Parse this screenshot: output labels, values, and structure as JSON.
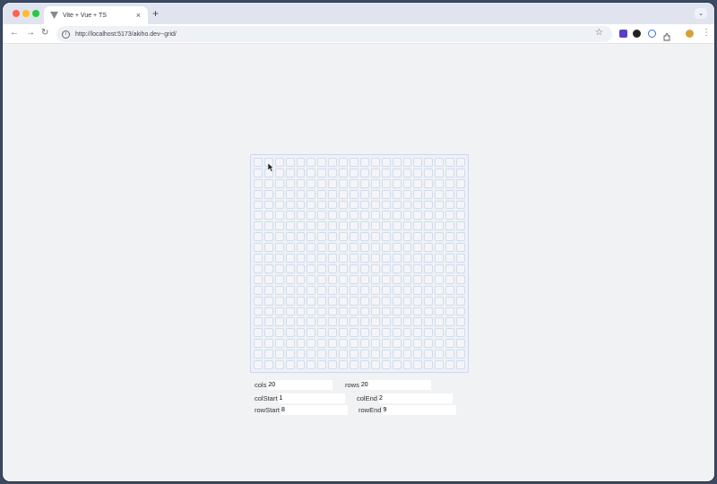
{
  "browser": {
    "tab_title": "Vite + Vue + TS",
    "tab_close": "×",
    "new_tab": "+",
    "tabstrip_menu": "⌄",
    "url": "http://localhost:5173/akiho.dev--grid/",
    "back": "←",
    "forward": "→",
    "reload": "↻",
    "star": "☆",
    "menu": "⋮"
  },
  "grid": {
    "cols": 20,
    "rows": 20
  },
  "controls": {
    "cols_label": "cols",
    "cols_value": "20",
    "rows_label": "rows",
    "rows_value": "20",
    "col_start_label": "colStart",
    "col_start_value": "1",
    "col_end_label": "colEnd",
    "col_end_value": "2",
    "row_start_label": "rowStart",
    "row_start_value": "8",
    "row_end_label": "rowEnd",
    "row_end_value": "9"
  },
  "colors": {
    "accent_extension": "#5b3fc4",
    "grid_border": "#d3dcea"
  },
  "icons": [
    "vite-favicon",
    "info-icon",
    "star-icon",
    "puzzle-icon",
    "avatar"
  ]
}
